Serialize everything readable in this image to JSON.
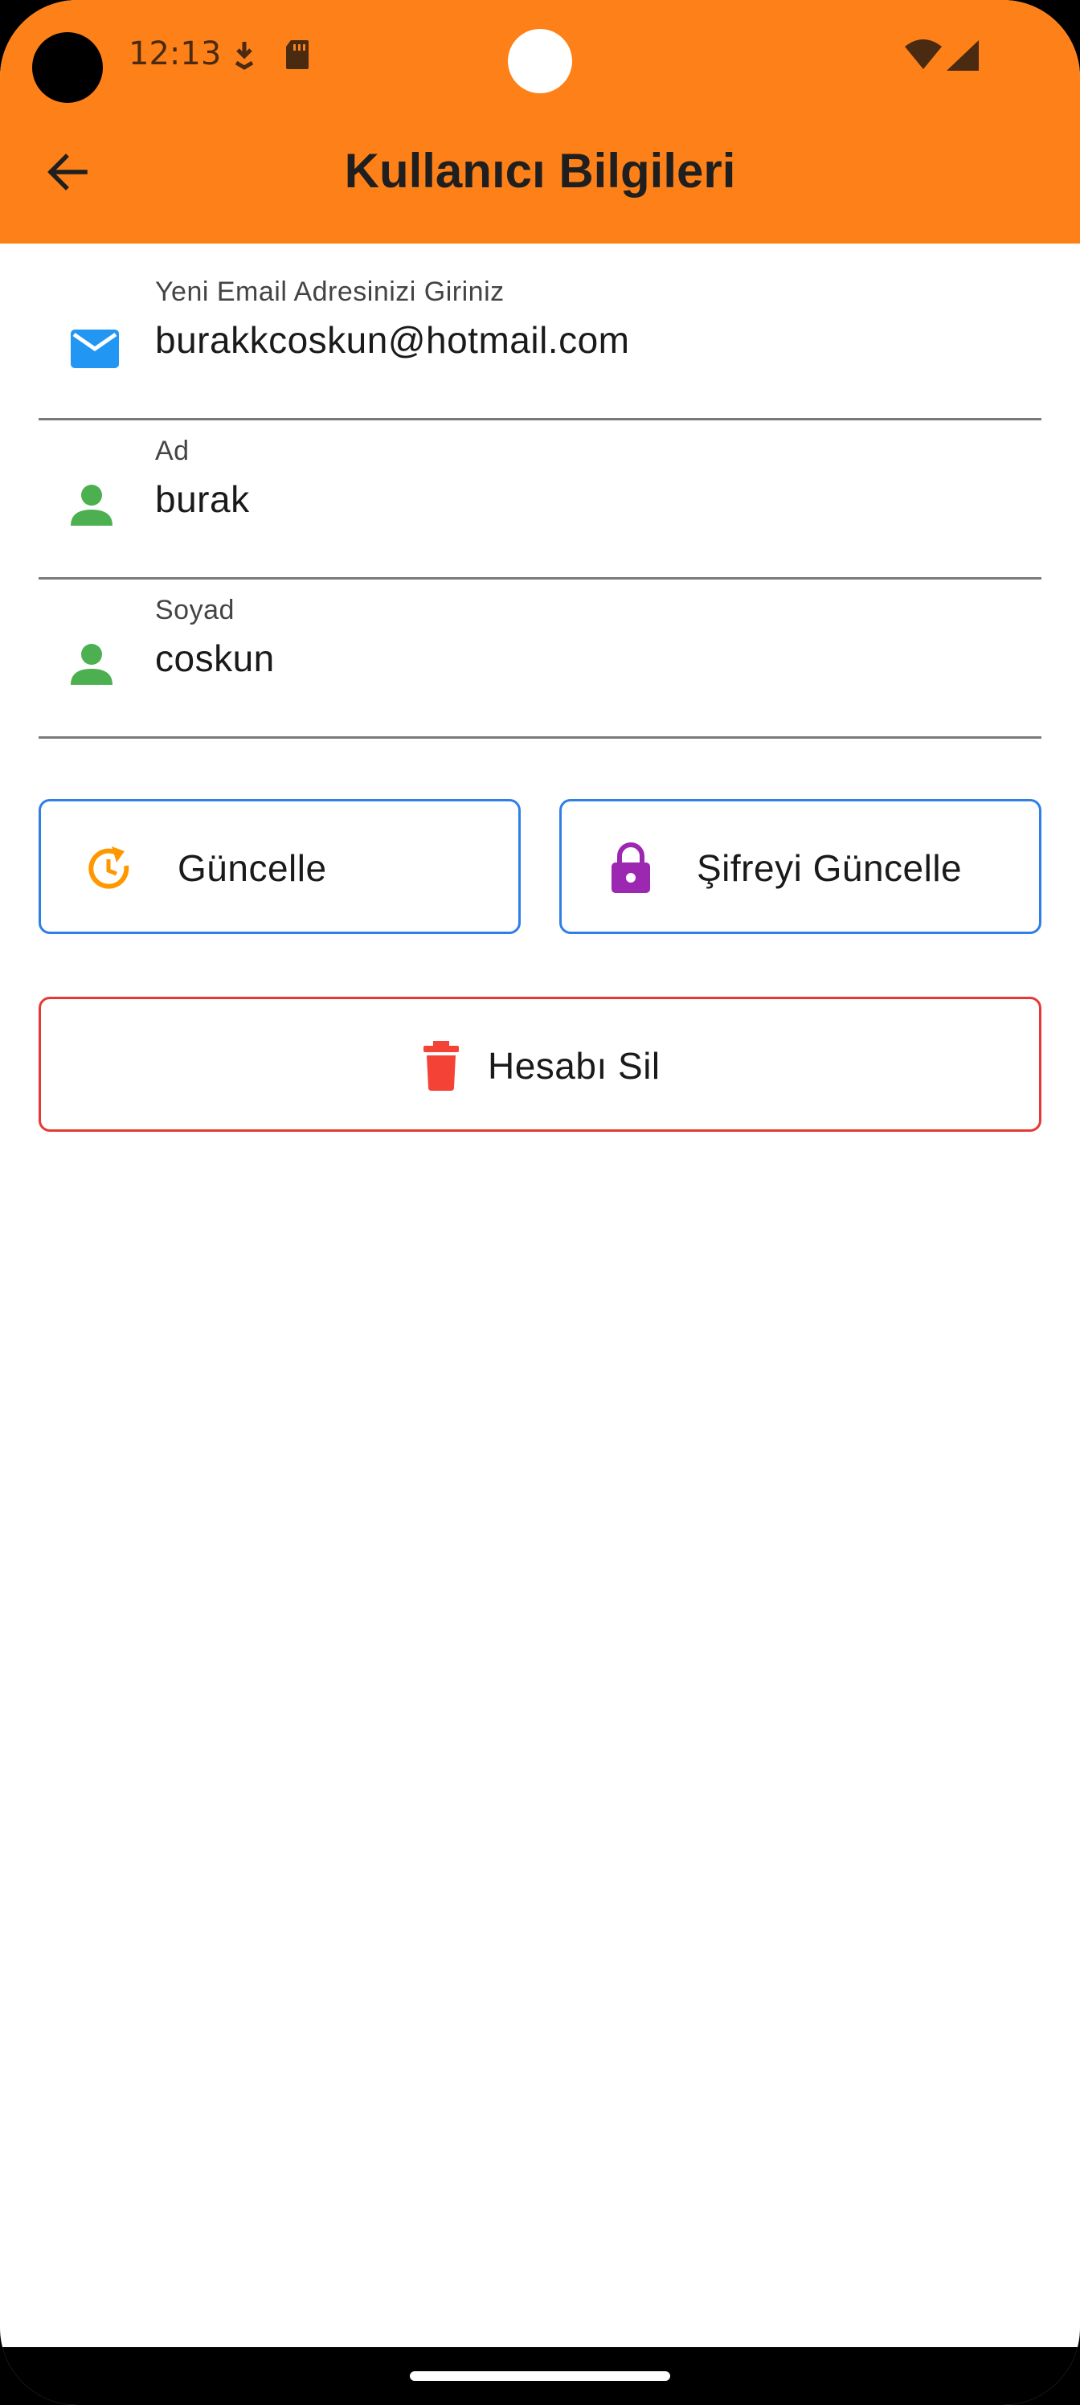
{
  "status_bar": {
    "time": "12:13",
    "icons": [
      "camera-hole",
      "download-icon",
      "sd-card-icon",
      "wifi-icon",
      "cell-signal-icon"
    ]
  },
  "header": {
    "title": "Kullanıcı Bilgileri",
    "back_icon": "arrow-left-icon",
    "background": "#fd8118"
  },
  "form": {
    "email": {
      "label": "Yeni Email Adresinizi Giriniz",
      "value": "burakkcoskun@hotmail.com",
      "icon": "mail-icon",
      "icon_color": "#2196f3"
    },
    "first_name": {
      "label": "Ad",
      "value": "burak",
      "icon": "person-icon",
      "icon_color": "#4caf50"
    },
    "last_name": {
      "label": "Soyad",
      "value": "coskun",
      "icon": "person-icon",
      "icon_color": "#4caf50"
    }
  },
  "actions": {
    "update": {
      "label": "Güncelle",
      "icon": "refresh-icon",
      "icon_color": "#ff9800",
      "border": "#2f7fe6"
    },
    "change_password": {
      "label": "Şifreyi Güncelle",
      "icon": "lock-icon",
      "icon_color": "#9c27b0",
      "border": "#2f7fe6"
    },
    "delete_account": {
      "label": "Hesabı Sil",
      "icon": "trash-icon",
      "icon_color": "#f44336",
      "border": "#e53935"
    }
  }
}
